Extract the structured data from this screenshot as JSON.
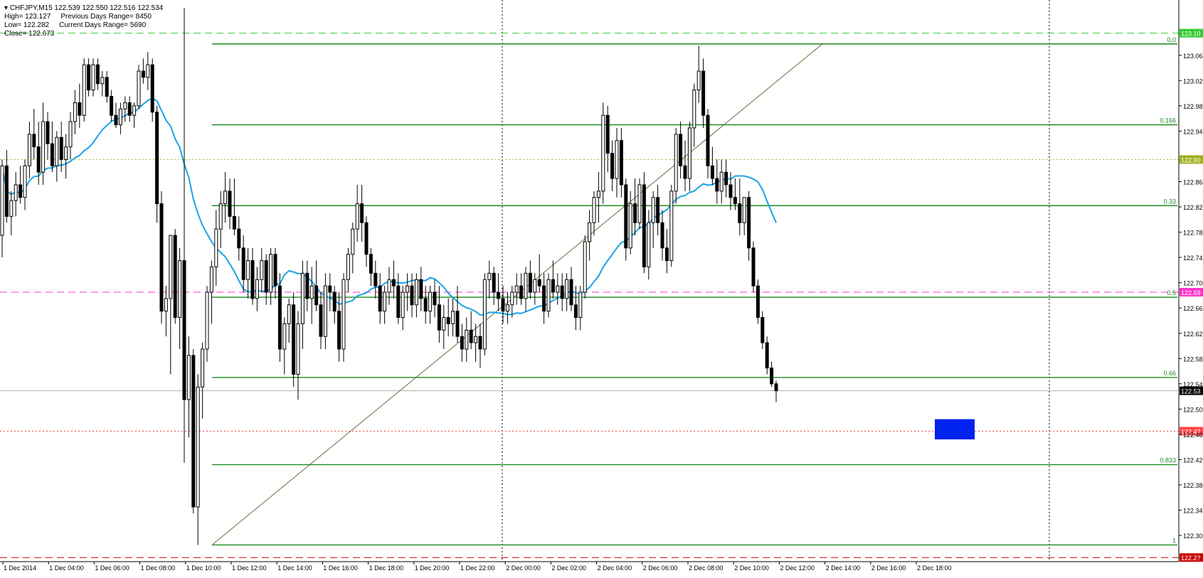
{
  "header": {
    "symbol_line": "CHFJPY,M15  122.539 122.550 122.516 122.534",
    "high": "High= 123.127",
    "low": "Low= 122.282",
    "close": "Close= 122.673",
    "prev_range": "Previous Days Range= 8450",
    "curr_range": "Current Days Range= 5690"
  },
  "colors": {
    "background": "#ffffff",
    "bull_candle": "#ffffff",
    "bear_candle": "#000000",
    "moving_average": "#1aa3e8",
    "fib_lines": "#1f8a1f",
    "high_level": "#33cc33",
    "magenta_level": "#ff33cc",
    "red_level": "#ff4444",
    "olive_level": "#a0b020",
    "target_box": "#0022ee"
  },
  "chart_data": {
    "type": "candlestick",
    "symbol": "CHFJPY",
    "timeframe": "M15",
    "ylim": [
      122.2635,
      123.1525
    ],
    "price_ticks": [
      "123.065",
      "123.025",
      "122.985",
      "122.945",
      "122.865",
      "122.825",
      "122.785",
      "122.745",
      "122.705",
      "122.665",
      "122.625",
      "122.585",
      "122.545",
      "122.505",
      "122.465",
      "122.425",
      "122.385",
      "122.345",
      "122.305"
    ],
    "time_labels": [
      "1 Dec 2014",
      "1 Dec 04:00",
      "1 Dec 06:00",
      "1 Dec 08:00",
      "1 Dec 10:00",
      "1 Dec 12:00",
      "1 Dec 14:00",
      "1 Dec 16:00",
      "1 Dec 18:00",
      "1 Dec 20:00",
      "1 Dec 22:00",
      "2 Dec 00:00",
      "2 Dec 02:00",
      "2 Dec 04:00",
      "2 Dec 06:00",
      "2 Dec 08:00",
      "2 Dec 10:00",
      "2 Dec 12:00",
      "2 Dec 14:00",
      "2 Dec 16:00",
      "2 Dec 18:00"
    ],
    "levels": [
      {
        "name": "high-level",
        "price": 123.1,
        "tag": "123.10",
        "style": "dashed"
      },
      {
        "name": "olive-level",
        "price": 122.9,
        "tag": "122.90",
        "style": "dotted"
      },
      {
        "name": "magenta-level",
        "price": 122.69,
        "tag": "122.69",
        "style": "dashed"
      },
      {
        "name": "current-price",
        "price": 122.534,
        "tag": "122.53",
        "style": "solid"
      },
      {
        "name": "red-level",
        "price": 122.47,
        "tag": "122.47",
        "style": "dotted"
      },
      {
        "name": "bottom-level",
        "price": 122.27,
        "tag": "122.2?",
        "style": "dashed"
      }
    ],
    "fibonacci": [
      {
        "ratio": "0.0",
        "price": 123.083
      },
      {
        "ratio": "0.166",
        "price": 122.955
      },
      {
        "ratio": "0.33",
        "price": 122.827
      },
      {
        "ratio": "0.5",
        "price": 122.682
      },
      {
        "ratio": "0.66",
        "price": 122.555
      },
      {
        "ratio": "0.833",
        "price": 122.417
      },
      {
        "ratio": "1",
        "price": 122.29
      }
    ],
    "fib_anchor": {
      "from": {
        "time": "1 Dec 10:30",
        "price": 122.29
      },
      "to": {
        "time": "2 Dec 14:00",
        "price": 123.083
      }
    },
    "target_zone": {
      "price_high": 122.489,
      "price_low": 122.457
    },
    "candles": [
      [
        122.78,
        122.9,
        122.745,
        122.89
      ],
      [
        122.89,
        122.915,
        122.8,
        122.81
      ],
      [
        122.81,
        122.85,
        122.78,
        122.835
      ],
      [
        122.835,
        122.88,
        122.81,
        122.86
      ],
      [
        122.86,
        122.89,
        122.83,
        122.84
      ],
      [
        122.84,
        122.9,
        122.82,
        122.89
      ],
      [
        122.89,
        122.96,
        122.87,
        122.94
      ],
      [
        122.94,
        122.98,
        122.9,
        122.92
      ],
      [
        122.92,
        122.96,
        122.86,
        122.88
      ],
      [
        122.88,
        122.99,
        122.86,
        122.96
      ],
      [
        122.96,
        122.975,
        122.9,
        122.925
      ],
      [
        122.925,
        122.96,
        122.88,
        122.89
      ],
      [
        122.89,
        122.945,
        122.865,
        122.935
      ],
      [
        122.935,
        122.96,
        122.88,
        122.9
      ],
      [
        122.9,
        122.94,
        122.87,
        122.92
      ],
      [
        122.92,
        122.975,
        122.9,
        122.96
      ],
      [
        122.96,
        123.01,
        122.94,
        122.99
      ],
      [
        122.99,
        123.02,
        122.95,
        122.97
      ],
      [
        122.97,
        123.06,
        122.96,
        123.05
      ],
      [
        123.05,
        123.06,
        123.0,
        123.01
      ],
      [
        123.01,
        123.06,
        123.0,
        123.05
      ],
      [
        123.05,
        123.06,
        123.01,
        123.02
      ],
      [
        123.02,
        123.04,
        123.0,
        123.03
      ],
      [
        123.03,
        123.04,
        122.99,
        123.0
      ],
      [
        123.0,
        123.01,
        122.96,
        122.97
      ],
      [
        122.97,
        122.99,
        122.95,
        122.955
      ],
      [
        122.955,
        122.99,
        122.94,
        122.98
      ],
      [
        122.98,
        123.0,
        122.96,
        122.99
      ],
      [
        122.99,
        123.0,
        122.96,
        122.97
      ],
      [
        122.97,
        122.99,
        122.95,
        122.985
      ],
      [
        122.985,
        123.05,
        122.98,
        123.04
      ],
      [
        123.04,
        123.06,
        123.02,
        123.03
      ],
      [
        123.03,
        123.07,
        123.01,
        123.05
      ],
      [
        123.05,
        123.06,
        122.96,
        122.975
      ],
      [
        122.975,
        122.985,
        122.8,
        122.83
      ],
      [
        122.83,
        122.85,
        122.64,
        122.66
      ],
      [
        122.66,
        122.7,
        122.62,
        122.68
      ],
      [
        122.68,
        122.78,
        122.56,
        122.78
      ],
      [
        122.78,
        122.79,
        122.64,
        122.65
      ],
      [
        122.65,
        122.76,
        122.6,
        122.74
      ],
      [
        122.74,
        123.14,
        122.42,
        122.52
      ],
      [
        122.52,
        122.62,
        122.46,
        122.59
      ],
      [
        122.59,
        122.6,
        122.34,
        122.35
      ],
      [
        122.35,
        122.56,
        122.29,
        122.54
      ],
      [
        122.54,
        122.61,
        122.49,
        122.6
      ],
      [
        122.6,
        122.7,
        122.58,
        122.69
      ],
      [
        122.69,
        122.74,
        122.64,
        122.73
      ],
      [
        122.73,
        122.82,
        122.7,
        122.79
      ],
      [
        122.79,
        122.85,
        122.76,
        122.83
      ],
      [
        122.83,
        122.88,
        122.8,
        122.85
      ],
      [
        122.85,
        122.87,
        122.79,
        122.81
      ],
      [
        122.81,
        122.87,
        122.78,
        122.79
      ],
      [
        122.79,
        122.81,
        122.74,
        122.76
      ],
      [
        122.76,
        122.78,
        122.69,
        122.71
      ],
      [
        122.71,
        122.76,
        122.68,
        122.74
      ],
      [
        122.74,
        122.76,
        122.67,
        122.68
      ],
      [
        122.68,
        122.73,
        122.66,
        122.71
      ],
      [
        122.71,
        122.76,
        122.69,
        122.74
      ],
      [
        122.74,
        122.75,
        122.67,
        122.69
      ],
      [
        122.69,
        122.76,
        122.67,
        122.75
      ],
      [
        122.75,
        122.76,
        122.68,
        122.7
      ],
      [
        122.7,
        122.72,
        122.58,
        122.6
      ],
      [
        122.6,
        122.65,
        122.56,
        122.64
      ],
      [
        122.64,
        122.68,
        122.61,
        122.67
      ],
      [
        122.67,
        122.69,
        122.54,
        122.56
      ],
      [
        122.56,
        122.66,
        122.52,
        122.64
      ],
      [
        122.64,
        122.74,
        122.6,
        122.72
      ],
      [
        122.72,
        122.74,
        122.66,
        122.68
      ],
      [
        122.68,
        122.73,
        122.64,
        122.7
      ],
      [
        122.7,
        122.74,
        122.66,
        122.67
      ],
      [
        122.67,
        122.69,
        122.6,
        122.62
      ],
      [
        122.62,
        122.72,
        122.6,
        122.7
      ],
      [
        122.7,
        122.72,
        122.66,
        122.69
      ],
      [
        122.69,
        122.7,
        122.64,
        122.66
      ],
      [
        122.66,
        122.69,
        122.58,
        122.6
      ],
      [
        122.6,
        122.72,
        122.58,
        122.71
      ],
      [
        122.71,
        122.76,
        122.69,
        122.75
      ],
      [
        122.75,
        122.8,
        122.72,
        122.79
      ],
      [
        122.79,
        122.86,
        122.77,
        122.83
      ],
      [
        122.83,
        122.86,
        122.77,
        122.8
      ],
      [
        122.8,
        122.81,
        122.73,
        122.75
      ],
      [
        122.75,
        122.76,
        122.7,
        122.72
      ],
      [
        122.72,
        122.74,
        122.68,
        122.7
      ],
      [
        122.7,
        122.72,
        122.64,
        122.66
      ],
      [
        122.66,
        122.7,
        122.64,
        122.69
      ],
      [
        122.69,
        122.73,
        122.67,
        122.71
      ],
      [
        122.71,
        122.74,
        122.68,
        122.7
      ],
      [
        122.7,
        122.72,
        122.64,
        122.65
      ],
      [
        122.65,
        122.7,
        122.63,
        122.69
      ],
      [
        122.69,
        122.72,
        122.66,
        122.7
      ],
      [
        122.7,
        122.72,
        122.65,
        122.67
      ],
      [
        122.67,
        122.72,
        122.65,
        122.71
      ],
      [
        122.71,
        122.73,
        122.66,
        122.68
      ],
      [
        122.68,
        122.7,
        122.64,
        122.66
      ],
      [
        122.66,
        122.7,
        122.64,
        122.69
      ],
      [
        122.69,
        122.71,
        122.65,
        122.67
      ],
      [
        122.67,
        122.7,
        122.61,
        122.63
      ],
      [
        122.63,
        122.67,
        122.6,
        122.65
      ],
      [
        122.65,
        122.68,
        122.62,
        122.64
      ],
      [
        122.64,
        122.68,
        122.62,
        122.66
      ],
      [
        122.66,
        122.7,
        122.61,
        122.62
      ],
      [
        122.62,
        122.64,
        122.58,
        122.6
      ],
      [
        122.6,
        122.65,
        122.58,
        122.63
      ],
      [
        122.63,
        122.66,
        122.6,
        122.61
      ],
      [
        122.61,
        122.64,
        122.58,
        122.62
      ],
      [
        122.62,
        122.64,
        122.57,
        122.6
      ],
      [
        122.6,
        122.72,
        122.59,
        122.71
      ],
      [
        122.71,
        122.74,
        122.68,
        122.72
      ],
      [
        122.72,
        122.73,
        122.67,
        122.69
      ],
      [
        122.69,
        122.72,
        122.66,
        122.68
      ],
      [
        122.68,
        122.7,
        122.64,
        122.66
      ],
      [
        122.66,
        122.69,
        122.64,
        122.67
      ],
      [
        122.67,
        122.7,
        122.65,
        122.69
      ],
      [
        122.69,
        122.72,
        122.67,
        122.7
      ],
      [
        122.7,
        122.72,
        122.67,
        122.68
      ],
      [
        122.68,
        122.73,
        122.66,
        122.72
      ],
      [
        122.72,
        122.74,
        122.68,
        122.69
      ],
      [
        122.69,
        122.72,
        122.67,
        122.71
      ],
      [
        122.71,
        122.75,
        122.69,
        122.7
      ],
      [
        122.7,
        122.72,
        122.64,
        122.66
      ],
      [
        122.66,
        122.72,
        122.65,
        122.71
      ],
      [
        122.71,
        122.74,
        122.68,
        122.69
      ],
      [
        122.69,
        122.72,
        122.67,
        122.7
      ],
      [
        122.7,
        122.72,
        122.66,
        122.68
      ],
      [
        122.68,
        122.72,
        122.66,
        122.71
      ],
      [
        122.71,
        122.73,
        122.66,
        122.67
      ],
      [
        122.67,
        122.7,
        122.63,
        122.65
      ],
      [
        122.65,
        122.7,
        122.63,
        122.69
      ],
      [
        122.69,
        122.78,
        122.68,
        122.77
      ],
      [
        122.77,
        122.82,
        122.74,
        122.8
      ],
      [
        122.8,
        122.85,
        122.78,
        122.84
      ],
      [
        122.84,
        122.88,
        122.8,
        122.85
      ],
      [
        122.85,
        122.99,
        122.83,
        122.97
      ],
      [
        122.97,
        122.985,
        122.88,
        122.91
      ],
      [
        122.91,
        122.93,
        122.85,
        122.87
      ],
      [
        122.87,
        122.95,
        122.84,
        122.93
      ],
      [
        122.93,
        122.95,
        122.84,
        122.86
      ],
      [
        122.86,
        122.87,
        122.74,
        122.76
      ],
      [
        122.76,
        122.85,
        122.75,
        122.83
      ],
      [
        122.83,
        122.87,
        122.78,
        122.8
      ],
      [
        122.8,
        122.87,
        122.79,
        122.86
      ],
      [
        122.86,
        122.88,
        122.72,
        122.73
      ],
      [
        122.73,
        122.82,
        122.71,
        122.8
      ],
      [
        122.8,
        122.85,
        122.76,
        122.84
      ],
      [
        122.84,
        122.86,
        122.78,
        122.8
      ],
      [
        122.8,
        122.82,
        122.74,
        122.76
      ],
      [
        122.76,
        122.79,
        122.72,
        122.74
      ],
      [
        122.74,
        122.86,
        122.73,
        122.85
      ],
      [
        122.85,
        122.95,
        122.83,
        122.94
      ],
      [
        122.94,
        122.96,
        122.87,
        122.89
      ],
      [
        122.89,
        122.93,
        122.85,
        122.87
      ],
      [
        122.87,
        122.96,
        122.85,
        122.95
      ],
      [
        122.95,
        123.02,
        122.92,
        123.01
      ],
      [
        123.01,
        123.08,
        122.99,
        123.04
      ],
      [
        123.04,
        123.06,
        122.95,
        122.97
      ],
      [
        122.97,
        122.98,
        122.87,
        122.89
      ],
      [
        122.89,
        122.92,
        122.86,
        122.87
      ],
      [
        122.87,
        122.9,
        122.83,
        122.85
      ],
      [
        122.85,
        122.9,
        122.83,
        122.88
      ],
      [
        122.88,
        122.9,
        122.84,
        122.86
      ],
      [
        122.86,
        122.88,
        122.82,
        122.84
      ],
      [
        122.84,
        122.87,
        122.82,
        122.83
      ],
      [
        122.83,
        122.87,
        122.78,
        122.8
      ],
      [
        122.8,
        122.84,
        122.78,
        122.84
      ],
      [
        122.84,
        122.85,
        122.74,
        122.76
      ],
      [
        122.76,
        122.77,
        122.69,
        122.7
      ],
      [
        122.7,
        122.71,
        122.64,
        122.65
      ],
      [
        122.65,
        122.66,
        122.6,
        122.61
      ],
      [
        122.61,
        122.62,
        122.56,
        122.57
      ],
      [
        122.57,
        122.58,
        122.54,
        122.545
      ],
      [
        122.545,
        122.55,
        122.516,
        122.534
      ]
    ]
  }
}
